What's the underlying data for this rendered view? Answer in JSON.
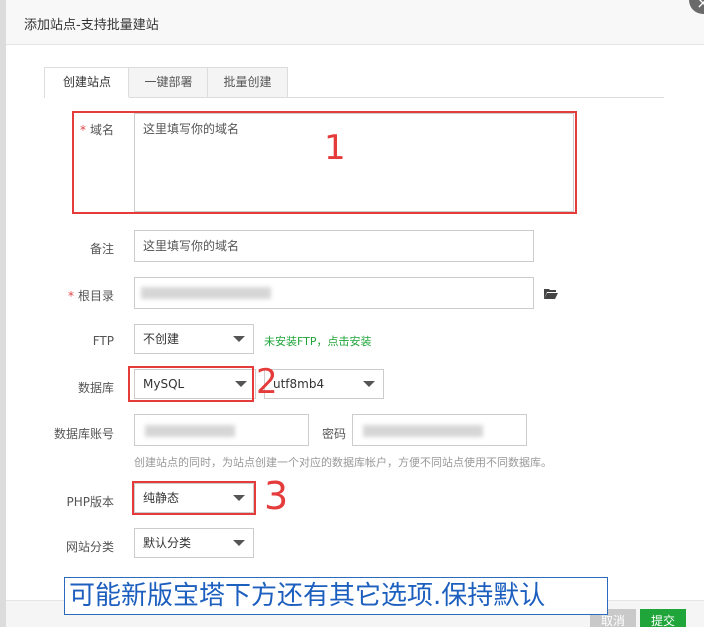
{
  "dialog": {
    "title": "添加站点-支持批量建站",
    "close_label": "×"
  },
  "tabs": [
    {
      "label": "创建站点",
      "active": true
    },
    {
      "label": "一键部署",
      "active": false
    },
    {
      "label": "批量创建",
      "active": false
    }
  ],
  "form": {
    "domain": {
      "label": "域名",
      "required": "*",
      "value": "这里填写你的域名"
    },
    "remark": {
      "label": "备注",
      "value": "这里填写你的域名"
    },
    "root": {
      "label": "根目录",
      "required": "*"
    },
    "ftp": {
      "label": "FTP",
      "selected": "不创建",
      "hint": "未安装FTP，点击安装"
    },
    "database": {
      "label": "数据库",
      "selected": "MySQL",
      "charset": "utf8mb4"
    },
    "db_account": {
      "label": "数据库账号",
      "password_label": "密码",
      "hint": "创建站点的同时，为站点创建一个对应的数据库帐户，方便不同站点使用不同数据库。"
    },
    "php": {
      "label": "PHP版本",
      "selected": "纯静态"
    },
    "category": {
      "label": "网站分类",
      "selected": "默认分类"
    }
  },
  "annotations": {
    "one": "1",
    "two": "2",
    "three": "3",
    "banner": "可能新版宝塔下方还有其它选项.保持默认"
  },
  "footer": {
    "cancel_label": "取消",
    "submit_label": "提交"
  },
  "colors": {
    "accent": "#20a53a",
    "annotation": "#e53b3b",
    "banner_text": "#1d5fbf"
  },
  "icons": {
    "folder": "folder-open-icon"
  }
}
